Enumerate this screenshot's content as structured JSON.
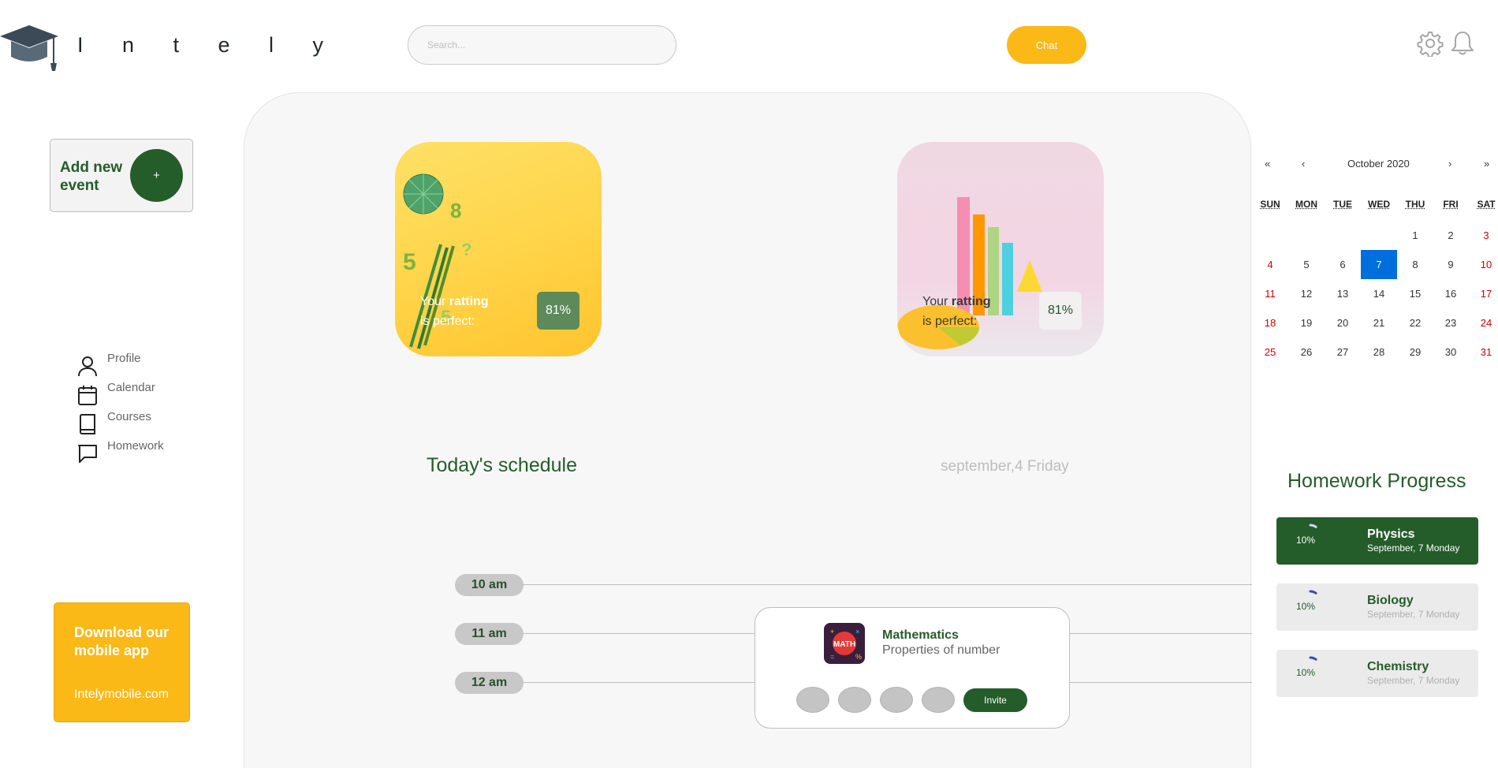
{
  "header": {
    "brand": "I n t e l y",
    "search_placeholder": "Search...",
    "chat_label": "Chat"
  },
  "sidebar": {
    "add_event_label": "Add new event",
    "add_event_button": "+",
    "nav": [
      {
        "label": "Profile",
        "icon": "user-icon"
      },
      {
        "label": "Calendar",
        "icon": "calendar-icon"
      },
      {
        "label": "Courses",
        "icon": "book-icon"
      },
      {
        "label": "Homework",
        "icon": "message-icon"
      }
    ],
    "download": {
      "title": "Download our mobile app",
      "link": "Intelymobile.com"
    }
  },
  "cards": [
    {
      "caption_pre": "Your ",
      "caption_bold": "ratting",
      "caption_post": "is perfect:",
      "value": "81%"
    },
    {
      "caption_pre": "Your ",
      "caption_bold": "ratting",
      "caption_post": "is perfect:",
      "value": "81%"
    }
  ],
  "schedule": {
    "title": "Today's schedule",
    "date": "september,4 Friday",
    "times": [
      "10 am",
      "11 am",
      "12 am"
    ],
    "event": {
      "subject": "Mathematics",
      "topic": "Properties of number",
      "invite_label": "Invite"
    }
  },
  "calendar": {
    "month_label": "October 2020",
    "nav": {
      "first": "«",
      "prev": "‹",
      "next": "›",
      "last": "»"
    },
    "weekdays": [
      "SUN",
      "MON",
      "TUE",
      "WED",
      "THU",
      "FRI",
      "SAT"
    ],
    "weeks": [
      [
        "",
        "",
        "",
        "",
        "1",
        "2",
        "3"
      ],
      [
        "4",
        "5",
        "6",
        "7",
        "8",
        "9",
        "10"
      ],
      [
        "11",
        "12",
        "13",
        "14",
        "15",
        "16",
        "17"
      ],
      [
        "18",
        "19",
        "20",
        "21",
        "22",
        "23",
        "24"
      ],
      [
        "25",
        "26",
        "27",
        "28",
        "29",
        "30",
        "31"
      ]
    ],
    "selected": "7"
  },
  "homework": {
    "title": "Homework Progress",
    "items": [
      {
        "subject": "Physics",
        "date": "September, 7 Monday",
        "percent": "10%",
        "progress": 0.1,
        "active": true
      },
      {
        "subject": "Biology",
        "date": "September, 7 Monday",
        "percent": "10%",
        "progress": 0.1,
        "active": false
      },
      {
        "subject": "Chemistry",
        "date": "September, 7 Monday",
        "percent": "10%",
        "progress": 0.1,
        "active": false
      }
    ]
  },
  "colors": {
    "brand_green": "#245c2a",
    "accent_yellow": "#fbb917",
    "calendar_selected": "#006edc",
    "weekend_red": "#d10000"
  }
}
